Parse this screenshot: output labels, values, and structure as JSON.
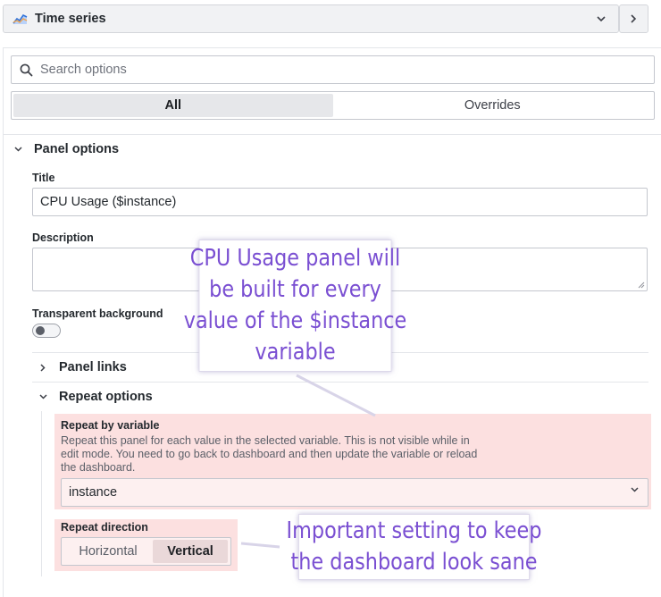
{
  "header": {
    "visualization_name": "Time series"
  },
  "search": {
    "placeholder": "Search options"
  },
  "tabs": {
    "all": "All",
    "overrides": "Overrides",
    "active": "All"
  },
  "panel_options": {
    "heading": "Panel options",
    "title_label": "Title",
    "title_value": "CPU Usage ($instance)",
    "description_label": "Description",
    "description_value": "",
    "transparent_label": "Transparent background",
    "transparent_on": false,
    "panel_links_heading": "Panel links",
    "repeat_options_heading": "Repeat options",
    "repeat_by_variable_label": "Repeat by variable",
    "repeat_by_variable_description": "Repeat this panel for each value in the selected variable. This is not visible while in edit mode. You need to go back to dashboard and then update the variable or reload the dashboard.",
    "repeat_variable_value": "instance",
    "repeat_direction_label": "Repeat direction",
    "direction_horizontal": "Horizontal",
    "direction_vertical": "Vertical",
    "direction_selected": "Vertical"
  },
  "annotations": {
    "note_1_lines": [
      "CPU Usage panel will",
      "be built for every",
      "value of the $instance",
      "variable"
    ],
    "note_2_lines": [
      "Important setting to keep",
      "the dashboard look sane"
    ]
  },
  "colors": {
    "highlight": "#fce0e0",
    "annotation_text": "#7a4fd2"
  }
}
